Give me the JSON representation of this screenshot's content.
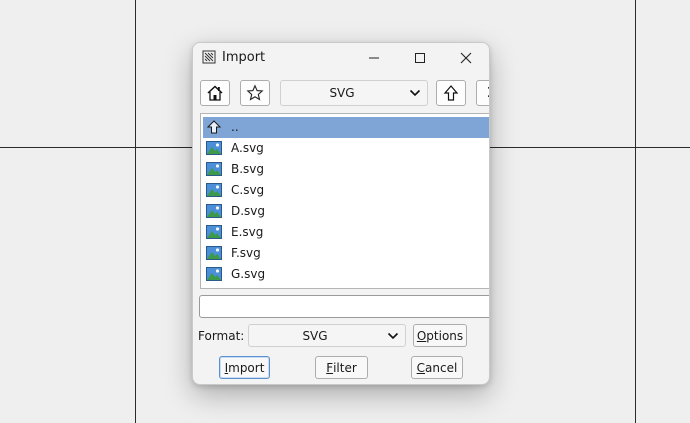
{
  "dialog": {
    "title": "Import",
    "title_icon": "import-app-icon"
  },
  "window_controls": {
    "minimize_icon": "minimize-icon",
    "maximize_icon": "maximize-icon",
    "close_icon": "close-icon"
  },
  "toolbar": {
    "home_icon": "home-icon",
    "favorites_icon": "star-icon",
    "path_combo_value": "SVG",
    "up_icon": "up-arrow-icon"
  },
  "file_list": {
    "items": [
      {
        "label": "..",
        "icon": "parent-folder-up-icon",
        "selected": true
      },
      {
        "label": "A.svg",
        "icon": "image-file-icon",
        "selected": false
      },
      {
        "label": "B.svg",
        "icon": "image-file-icon",
        "selected": false
      },
      {
        "label": "C.svg",
        "icon": "image-file-icon",
        "selected": false
      },
      {
        "label": "D.svg",
        "icon": "image-file-icon",
        "selected": false
      },
      {
        "label": "E.svg",
        "icon": "image-file-icon",
        "selected": false
      },
      {
        "label": "F.svg",
        "icon": "image-file-icon",
        "selected": false
      },
      {
        "label": "G.svg",
        "icon": "image-file-icon",
        "selected": false
      }
    ]
  },
  "filename_input": {
    "value": ""
  },
  "format": {
    "label": "Format:",
    "value": "SVG",
    "options_button": {
      "mnemonic": "O",
      "rest": "ptions"
    }
  },
  "buttons": {
    "import": {
      "mnemonic": "I",
      "rest": "mport"
    },
    "filter": {
      "mnemonic": "F",
      "rest": "ilter"
    },
    "cancel": {
      "mnemonic": "C",
      "rest": "ancel"
    }
  },
  "colors": {
    "selection": "#7fa5d6",
    "image_icon_green": "#3c9a4a",
    "image_icon_sky": "#4a8fd8",
    "default_button_border": "#5a8fd0"
  }
}
